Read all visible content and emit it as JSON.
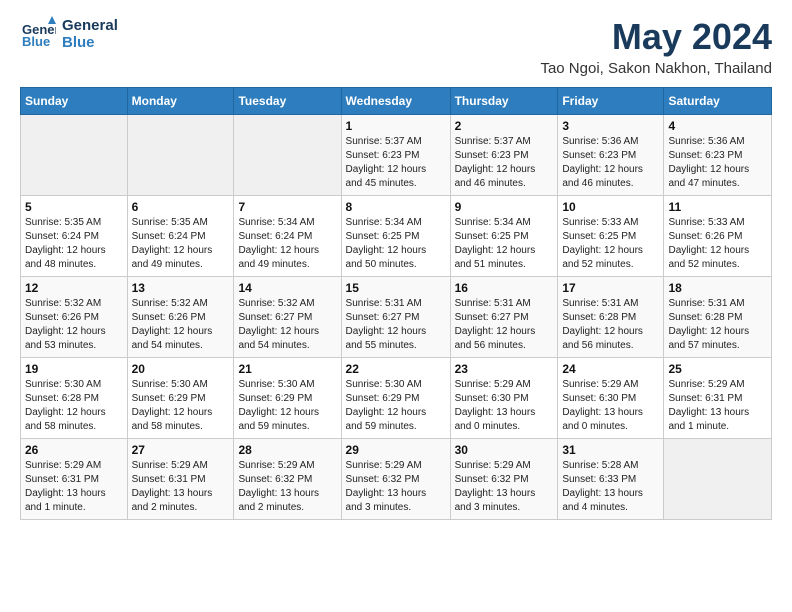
{
  "logo": {
    "line1": "General",
    "line2": "Blue"
  },
  "title": "May 2024",
  "location": "Tao Ngoi, Sakon Nakhon, Thailand",
  "weekdays": [
    "Sunday",
    "Monday",
    "Tuesday",
    "Wednesday",
    "Thursday",
    "Friday",
    "Saturday"
  ],
  "weeks": [
    [
      {
        "day": "",
        "info": ""
      },
      {
        "day": "",
        "info": ""
      },
      {
        "day": "",
        "info": ""
      },
      {
        "day": "1",
        "info": "Sunrise: 5:37 AM\nSunset: 6:23 PM\nDaylight: 12 hours\nand 45 minutes."
      },
      {
        "day": "2",
        "info": "Sunrise: 5:37 AM\nSunset: 6:23 PM\nDaylight: 12 hours\nand 46 minutes."
      },
      {
        "day": "3",
        "info": "Sunrise: 5:36 AM\nSunset: 6:23 PM\nDaylight: 12 hours\nand 46 minutes."
      },
      {
        "day": "4",
        "info": "Sunrise: 5:36 AM\nSunset: 6:23 PM\nDaylight: 12 hours\nand 47 minutes."
      }
    ],
    [
      {
        "day": "5",
        "info": "Sunrise: 5:35 AM\nSunset: 6:24 PM\nDaylight: 12 hours\nand 48 minutes."
      },
      {
        "day": "6",
        "info": "Sunrise: 5:35 AM\nSunset: 6:24 PM\nDaylight: 12 hours\nand 49 minutes."
      },
      {
        "day": "7",
        "info": "Sunrise: 5:34 AM\nSunset: 6:24 PM\nDaylight: 12 hours\nand 49 minutes."
      },
      {
        "day": "8",
        "info": "Sunrise: 5:34 AM\nSunset: 6:25 PM\nDaylight: 12 hours\nand 50 minutes."
      },
      {
        "day": "9",
        "info": "Sunrise: 5:34 AM\nSunset: 6:25 PM\nDaylight: 12 hours\nand 51 minutes."
      },
      {
        "day": "10",
        "info": "Sunrise: 5:33 AM\nSunset: 6:25 PM\nDaylight: 12 hours\nand 52 minutes."
      },
      {
        "day": "11",
        "info": "Sunrise: 5:33 AM\nSunset: 6:26 PM\nDaylight: 12 hours\nand 52 minutes."
      }
    ],
    [
      {
        "day": "12",
        "info": "Sunrise: 5:32 AM\nSunset: 6:26 PM\nDaylight: 12 hours\nand 53 minutes."
      },
      {
        "day": "13",
        "info": "Sunrise: 5:32 AM\nSunset: 6:26 PM\nDaylight: 12 hours\nand 54 minutes."
      },
      {
        "day": "14",
        "info": "Sunrise: 5:32 AM\nSunset: 6:27 PM\nDaylight: 12 hours\nand 54 minutes."
      },
      {
        "day": "15",
        "info": "Sunrise: 5:31 AM\nSunset: 6:27 PM\nDaylight: 12 hours\nand 55 minutes."
      },
      {
        "day": "16",
        "info": "Sunrise: 5:31 AM\nSunset: 6:27 PM\nDaylight: 12 hours\nand 56 minutes."
      },
      {
        "day": "17",
        "info": "Sunrise: 5:31 AM\nSunset: 6:28 PM\nDaylight: 12 hours\nand 56 minutes."
      },
      {
        "day": "18",
        "info": "Sunrise: 5:31 AM\nSunset: 6:28 PM\nDaylight: 12 hours\nand 57 minutes."
      }
    ],
    [
      {
        "day": "19",
        "info": "Sunrise: 5:30 AM\nSunset: 6:28 PM\nDaylight: 12 hours\nand 58 minutes."
      },
      {
        "day": "20",
        "info": "Sunrise: 5:30 AM\nSunset: 6:29 PM\nDaylight: 12 hours\nand 58 minutes."
      },
      {
        "day": "21",
        "info": "Sunrise: 5:30 AM\nSunset: 6:29 PM\nDaylight: 12 hours\nand 59 minutes."
      },
      {
        "day": "22",
        "info": "Sunrise: 5:30 AM\nSunset: 6:29 PM\nDaylight: 12 hours\nand 59 minutes."
      },
      {
        "day": "23",
        "info": "Sunrise: 5:29 AM\nSunset: 6:30 PM\nDaylight: 13 hours\nand 0 minutes."
      },
      {
        "day": "24",
        "info": "Sunrise: 5:29 AM\nSunset: 6:30 PM\nDaylight: 13 hours\nand 0 minutes."
      },
      {
        "day": "25",
        "info": "Sunrise: 5:29 AM\nSunset: 6:31 PM\nDaylight: 13 hours\nand 1 minute."
      }
    ],
    [
      {
        "day": "26",
        "info": "Sunrise: 5:29 AM\nSunset: 6:31 PM\nDaylight: 13 hours\nand 1 minute."
      },
      {
        "day": "27",
        "info": "Sunrise: 5:29 AM\nSunset: 6:31 PM\nDaylight: 13 hours\nand 2 minutes."
      },
      {
        "day": "28",
        "info": "Sunrise: 5:29 AM\nSunset: 6:32 PM\nDaylight: 13 hours\nand 2 minutes."
      },
      {
        "day": "29",
        "info": "Sunrise: 5:29 AM\nSunset: 6:32 PM\nDaylight: 13 hours\nand 3 minutes."
      },
      {
        "day": "30",
        "info": "Sunrise: 5:29 AM\nSunset: 6:32 PM\nDaylight: 13 hours\nand 3 minutes."
      },
      {
        "day": "31",
        "info": "Sunrise: 5:28 AM\nSunset: 6:33 PM\nDaylight: 13 hours\nand 4 minutes."
      },
      {
        "day": "",
        "info": ""
      }
    ]
  ]
}
